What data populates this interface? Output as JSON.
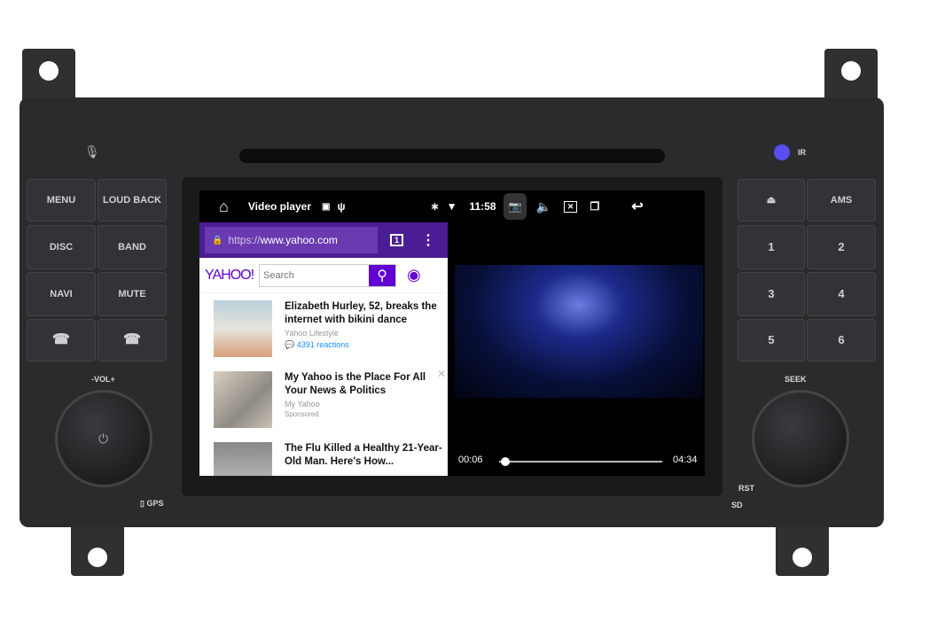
{
  "device": {
    "left_buttons": [
      "MENU",
      "LOUD BACK",
      "DISC",
      "BAND",
      "NAVI",
      "MUTE"
    ],
    "right_buttons": [
      "AMS",
      "1",
      "2",
      "3",
      "4",
      "5",
      "6"
    ],
    "vol_label": "-VOL+",
    "seek_label": "SEEK",
    "gps_label": "GPS",
    "rst_label": "RST",
    "ir_label": "IR",
    "sd_label": "SD"
  },
  "status_bar": {
    "app_title": "Video player",
    "time": "11:58"
  },
  "browser": {
    "url_scheme": "https://",
    "url_host": "www.yahoo.com",
    "tab_count": "1",
    "logo": "YAHOO!",
    "search_placeholder": "Search",
    "articles": [
      {
        "title": "Elizabeth Hurley, 52, breaks the internet with bikini dance",
        "source": "Yahoo Lifestyle",
        "reactions": "4391 reactions"
      },
      {
        "title": "My Yahoo is the Place For All Your News & Politics",
        "source": "My Yahoo",
        "sponsored": "Sponsored"
      },
      {
        "title": "The Flu Killed a Healthy 21-Year-Old Man. Here's How..."
      }
    ]
  },
  "player": {
    "elapsed": "00:06",
    "duration": "04:34",
    "progress": 0.022
  },
  "colors": {
    "yahoo_purple": "#6001d2",
    "urlbar": "#4b1d95",
    "link_blue": "#188fff"
  }
}
